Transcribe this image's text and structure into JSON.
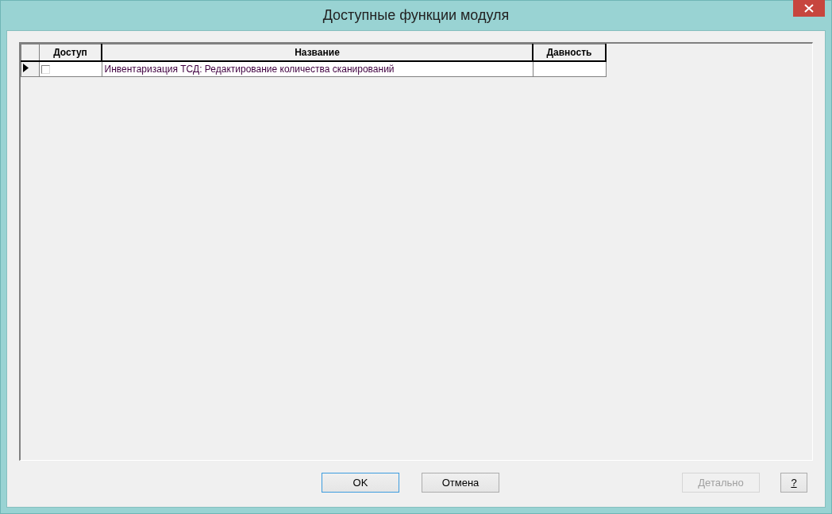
{
  "window": {
    "title": "Доступные функции модуля"
  },
  "table": {
    "columns": [
      "Доступ",
      "Название",
      "Давность"
    ],
    "rows": [
      {
        "current": true,
        "access_checked": false,
        "name": "Инвентаризация ТСД: Редактирование количества сканирований"
      }
    ]
  },
  "buttons": [
    {
      "label": "OK",
      "focused": true,
      "disabled": false
    },
    {
      "label": "Отмена",
      "focused": false,
      "disabled": false
    },
    {
      "label": "Детально",
      "focused": false,
      "disabled": true
    },
    {
      "label": "?",
      "focused": false,
      "disabled": false
    }
  ]
}
